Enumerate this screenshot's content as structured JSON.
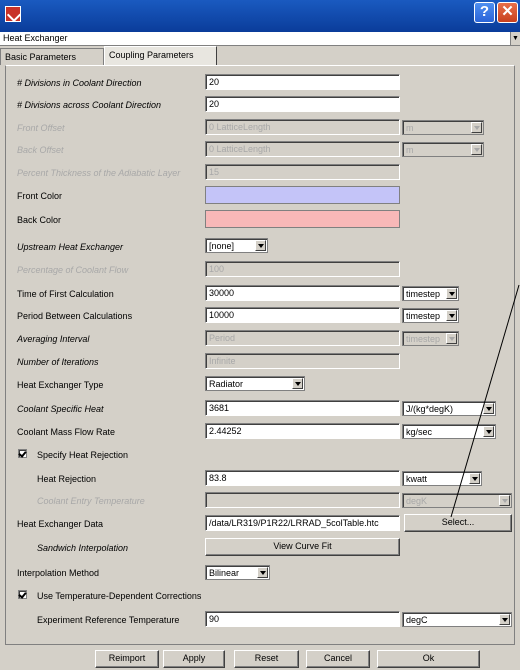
{
  "window": {
    "help_glyph": "?",
    "close_glyph": "✕"
  },
  "header_select": {
    "value": "Heat Exchanger"
  },
  "tabs": [
    {
      "label": "Basic Parameters"
    },
    {
      "label": "Coupling Parameters"
    }
  ],
  "form": {
    "div_coolant": {
      "label": "# Divisions in Coolant Direction",
      "value": "20"
    },
    "div_across": {
      "label": "# Divisions across Coolant Direction",
      "value": "20"
    },
    "front_offset": {
      "label": "Front Offset",
      "value": "0 LatticeLength",
      "unit": "m"
    },
    "back_offset": {
      "label": "Back Offset",
      "value": "0 LatticeLength",
      "unit": "m"
    },
    "pct_thickness": {
      "label": "Percent Thickness of the Adiabatic Layer",
      "value": "15"
    },
    "front_color": {
      "label": "Front Color",
      "color": "#c4c4f8"
    },
    "back_color": {
      "label": "Back Color",
      "color": "#f8b8b8"
    },
    "upstream": {
      "label": "Upstream Heat Exchanger",
      "value": "[none]"
    },
    "pct_coolant": {
      "label": "Percentage of Coolant Flow",
      "value": "100"
    },
    "time_first": {
      "label": "Time of First Calculation",
      "value": "30000",
      "unit": "timestep"
    },
    "period_between": {
      "label": "Period Between Calculations",
      "value": "10000",
      "unit": "timestep"
    },
    "averaging": {
      "label": "Averaging Interval",
      "value": "Period",
      "unit": "timestep"
    },
    "num_iterations": {
      "label": "Number of Iterations",
      "value": "Infinite"
    },
    "hx_type": {
      "label": "Heat Exchanger Type",
      "value": "Radiator"
    },
    "coolant_specific_heat": {
      "label": "Coolant Specific Heat",
      "value": "3681",
      "unit": "J/(kg*degK)"
    },
    "coolant_mass_flow": {
      "label": "Coolant Mass Flow Rate",
      "value": "2.44252",
      "unit": "kg/sec"
    },
    "specify_heat_rejection": {
      "label": "Specify Heat Rejection"
    },
    "heat_rejection": {
      "label": "Heat Rejection",
      "value": "83.8",
      "unit": "kwatt"
    },
    "coolant_entry_temp": {
      "label": "Coolant Entry Temperature",
      "value": "",
      "unit": "degK"
    },
    "hx_data": {
      "label": "Heat Exchanger Data",
      "value": "/data/LR319/P1R22/LRRAD_5colTable.htc",
      "button": "Select..."
    },
    "sandwich": {
      "label": "Sandwich Interpolation",
      "button": "View Curve Fit"
    },
    "interp_method": {
      "label": "Interpolation Method",
      "value": "Bilinear"
    },
    "use_temp_dep": {
      "label": "Use Temperature-Dependent Corrections"
    },
    "exp_ref_temp": {
      "label": "Experiment Reference Temperature",
      "value": "90",
      "unit": "degC"
    }
  },
  "footer": {
    "reimport": "Reimport",
    "apply": "Apply",
    "reset": "Reset",
    "cancel": "Cancel",
    "ok": "Ok"
  }
}
